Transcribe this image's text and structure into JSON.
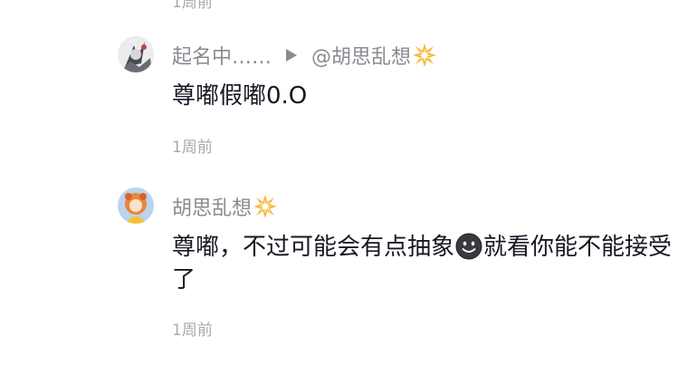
{
  "top_partial_time": "1周前",
  "comments": [
    {
      "username": "起名中……",
      "reply_target": "@胡思乱想",
      "username_icon": "burst-sparkle-icon",
      "text": "尊嘟假嘟0.O",
      "time": "1周前"
    },
    {
      "username": "胡思乱想",
      "username_icon": "burst-sparkle-icon",
      "text_before_emoji": "尊嘟，不过可能会有点抽象",
      "emoji": "dark-smiley-emoji",
      "text_after_emoji": "就看你能不能接受了",
      "time": "1周前"
    }
  ],
  "colors": {
    "text_primary": "#161823",
    "text_secondary": "#8a8b91",
    "text_time": "#a8a9ad",
    "sparkle": "#f5a623"
  }
}
